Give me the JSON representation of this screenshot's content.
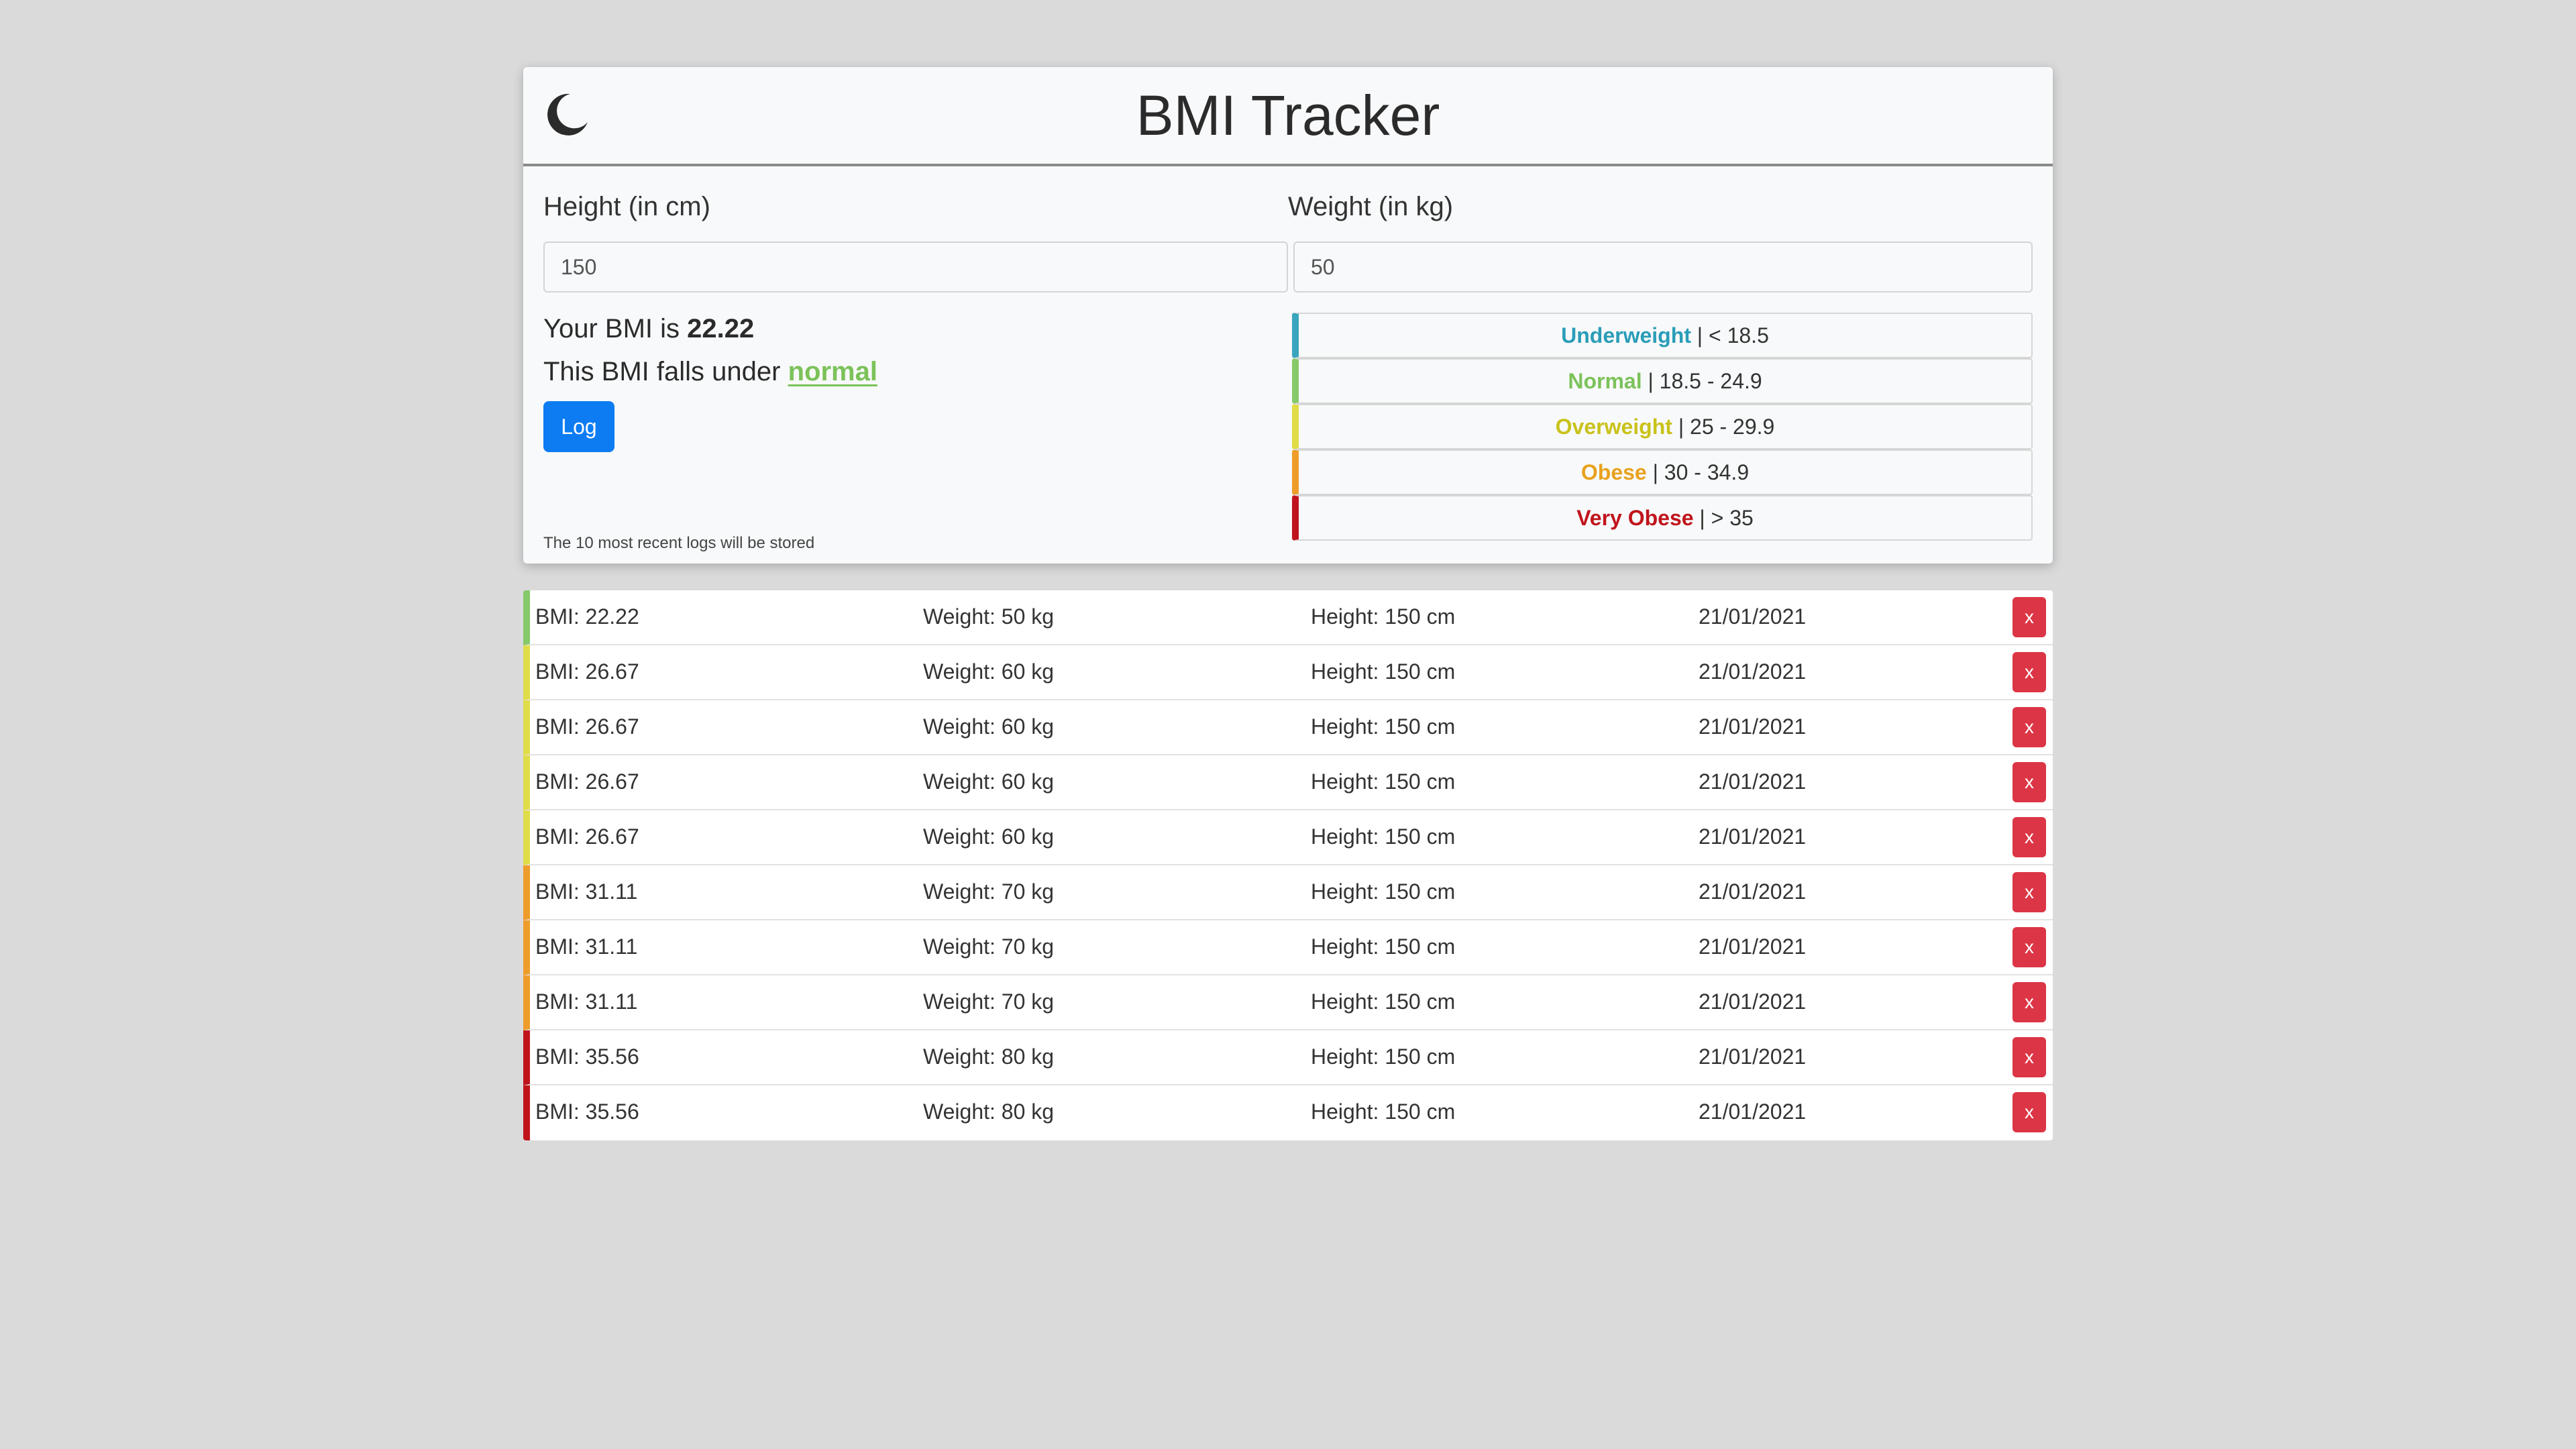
{
  "header": {
    "title": "BMI Tracker",
    "theme_toggle_icon": "moon-icon"
  },
  "form": {
    "height_label": "Height (in cm)",
    "height_value": "150",
    "weight_label": "Weight (in kg)",
    "weight_value": "50"
  },
  "result": {
    "bmi_prefix": "Your BMI is ",
    "bmi_value": "22.22",
    "class_prefix": "This BMI falls under ",
    "class_value": "normal",
    "class_color": "#7cc25a"
  },
  "log_button_label": "Log",
  "storage_note": "The 10 most recent logs will be stored",
  "categories": [
    {
      "name": "Underweight",
      "range": " | < 18.5",
      "color": "#2a9db8"
    },
    {
      "name": "Normal",
      "range": " | 18.5 - 24.9",
      "color": "#7cc25a"
    },
    {
      "name": "Overweight",
      "range": " | 25 - 29.9",
      "color": "#c9c21a"
    },
    {
      "name": "Obese",
      "range": " | 30 - 34.9",
      "color": "#e8a21e"
    },
    {
      "name": "Very Obese",
      "range": " | > 35",
      "color": "#c0141c"
    }
  ],
  "category_border_colors": [
    "#3aa6bd",
    "#86c96a",
    "#e0dc48",
    "#ee9d2a",
    "#c0141c"
  ],
  "logs": [
    {
      "bmi": "BMI: 22.22",
      "weight": "Weight: 50 kg",
      "height": "Height: 150 cm",
      "date": "21/01/2021",
      "color": "#86c96a",
      "delete_label": "x"
    },
    {
      "bmi": "BMI: 26.67",
      "weight": "Weight: 60 kg",
      "height": "Height: 150 cm",
      "date": "21/01/2021",
      "color": "#e0dc48",
      "delete_label": "x"
    },
    {
      "bmi": "BMI: 26.67",
      "weight": "Weight: 60 kg",
      "height": "Height: 150 cm",
      "date": "21/01/2021",
      "color": "#e0dc48",
      "delete_label": "x"
    },
    {
      "bmi": "BMI: 26.67",
      "weight": "Weight: 60 kg",
      "height": "Height: 150 cm",
      "date": "21/01/2021",
      "color": "#e0dc48",
      "delete_label": "x"
    },
    {
      "bmi": "BMI: 26.67",
      "weight": "Weight: 60 kg",
      "height": "Height: 150 cm",
      "date": "21/01/2021",
      "color": "#e0dc48",
      "delete_label": "x"
    },
    {
      "bmi": "BMI: 31.11",
      "weight": "Weight: 70 kg",
      "height": "Height: 150 cm",
      "date": "21/01/2021",
      "color": "#ee9d2a",
      "delete_label": "x"
    },
    {
      "bmi": "BMI: 31.11",
      "weight": "Weight: 70 kg",
      "height": "Height: 150 cm",
      "date": "21/01/2021",
      "color": "#ee9d2a",
      "delete_label": "x"
    },
    {
      "bmi": "BMI: 31.11",
      "weight": "Weight: 70 kg",
      "height": "Height: 150 cm",
      "date": "21/01/2021",
      "color": "#ee9d2a",
      "delete_label": "x"
    },
    {
      "bmi": "BMI: 35.56",
      "weight": "Weight: 80 kg",
      "height": "Height: 150 cm",
      "date": "21/01/2021",
      "color": "#c0141c",
      "delete_label": "x"
    },
    {
      "bmi": "BMI: 35.56",
      "weight": "Weight: 80 kg",
      "height": "Height: 150 cm",
      "date": "21/01/2021",
      "color": "#c0141c",
      "delete_label": "x"
    }
  ]
}
